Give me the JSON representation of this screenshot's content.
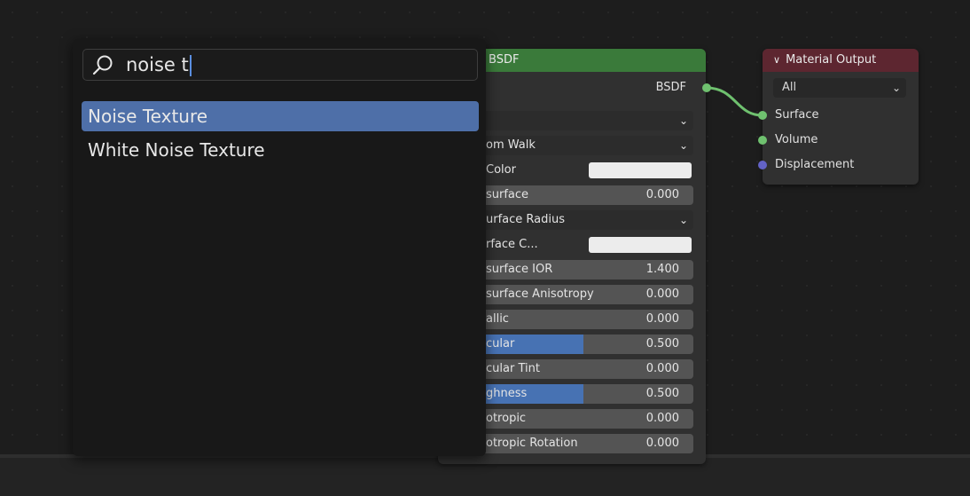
{
  "bsdf_node": {
    "title": "cipled BSDF",
    "output_label": "BSDF",
    "rows": [
      {
        "kind": "dropdown",
        "label": ""
      },
      {
        "kind": "dropdown",
        "label": "om Walk"
      },
      {
        "kind": "color",
        "label": "Color"
      },
      {
        "kind": "value",
        "label": "surface",
        "value": "0.000"
      },
      {
        "kind": "dropdown",
        "label": "urface Radius"
      },
      {
        "kind": "color",
        "label": "rface C..."
      },
      {
        "kind": "value",
        "label": "surface IOR",
        "value": "1.400"
      },
      {
        "kind": "value",
        "label": "surface Anisotropy",
        "value": "0.000"
      },
      {
        "kind": "value",
        "label": "allic",
        "value": "0.000"
      },
      {
        "kind": "value",
        "label": "cular",
        "value": "0.500",
        "fill": 0.5
      },
      {
        "kind": "value",
        "label": "cular Tint",
        "value": "0.000"
      },
      {
        "kind": "value",
        "label": "ghness",
        "value": "0.500",
        "fill": 0.5
      },
      {
        "kind": "value",
        "label": "otropic",
        "value": "0.000"
      },
      {
        "kind": "value",
        "label": "otropic Rotation",
        "value": "0.000"
      }
    ]
  },
  "material_output": {
    "title": "Material Output",
    "target_select": "All",
    "sockets": [
      "Surface",
      "Volume",
      "Displacement"
    ]
  },
  "search_popup": {
    "query": "noise t",
    "results": [
      "Noise Texture",
      "White Noise Texture"
    ],
    "selected_index": 0
  },
  "colors": {
    "bsdf_header": "#3a7a3a",
    "output_header": "#5d2630",
    "selection": "#4e6fa8",
    "slider_fill": "#4772b3",
    "socket_green": "#6fc16f",
    "socket_purple": "#6363c7"
  }
}
